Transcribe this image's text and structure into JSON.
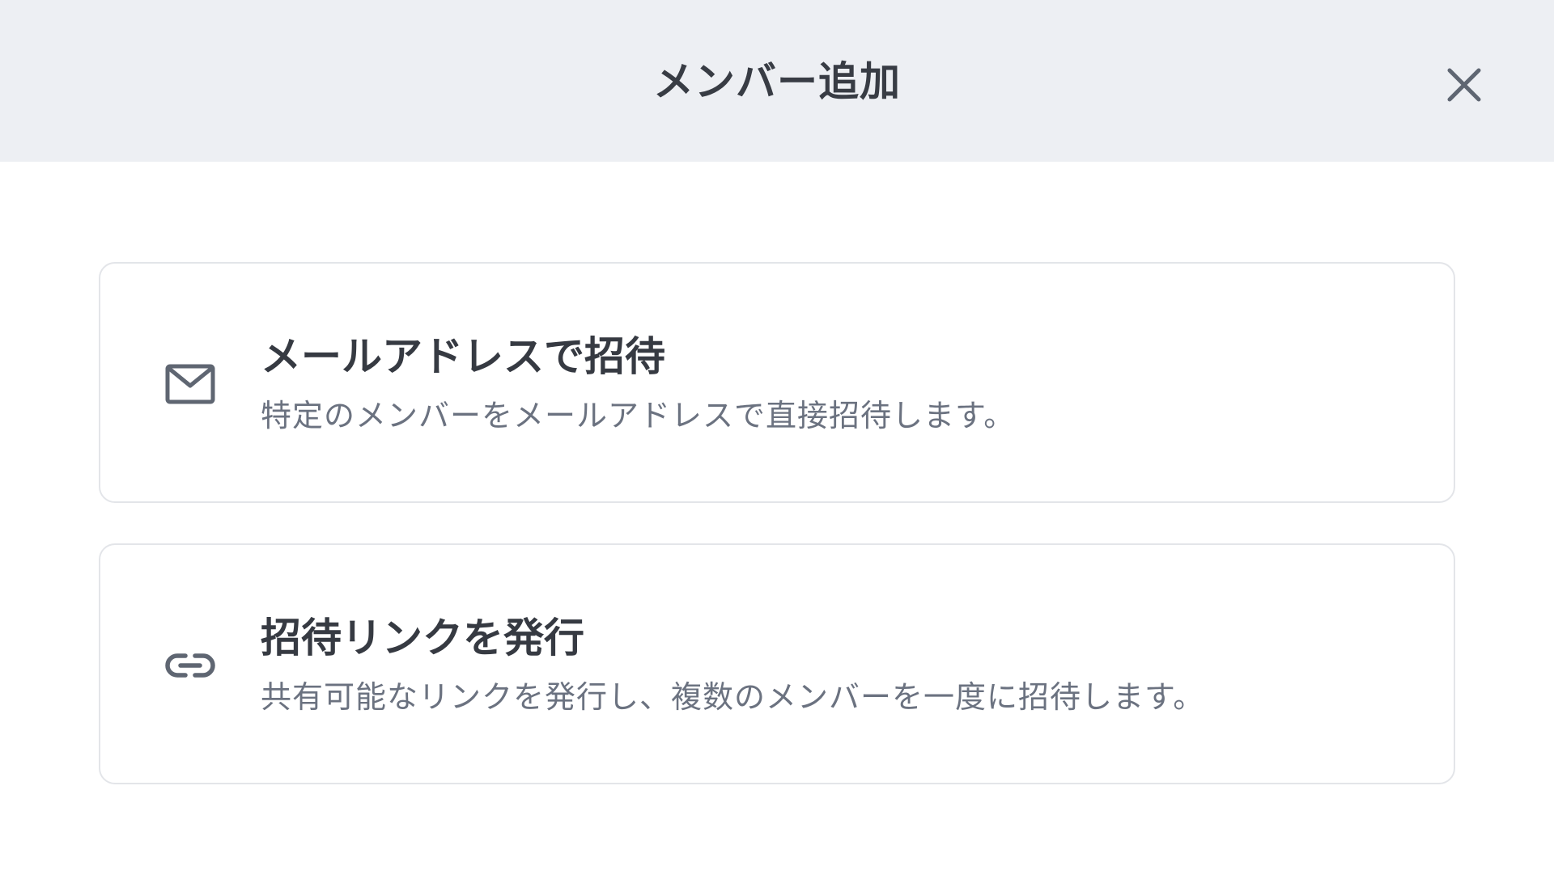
{
  "dialog": {
    "title": "メンバー追加",
    "close_icon": "close-icon"
  },
  "options": [
    {
      "icon": "mail-icon",
      "title": "メールアドレスで招待",
      "description": "特定のメンバーをメールアドレスで直接招待します。"
    },
    {
      "icon": "link-icon",
      "title": "招待リンクを発行",
      "description": "共有可能なリンクを発行し、複数のメンバーを一度に招待します。"
    }
  ],
  "colors": {
    "header_bg": "#edeff3",
    "card_border": "#e3e5e9",
    "title_text": "#363a42",
    "desc_text": "#6b7280",
    "icon": "#5f6672"
  }
}
